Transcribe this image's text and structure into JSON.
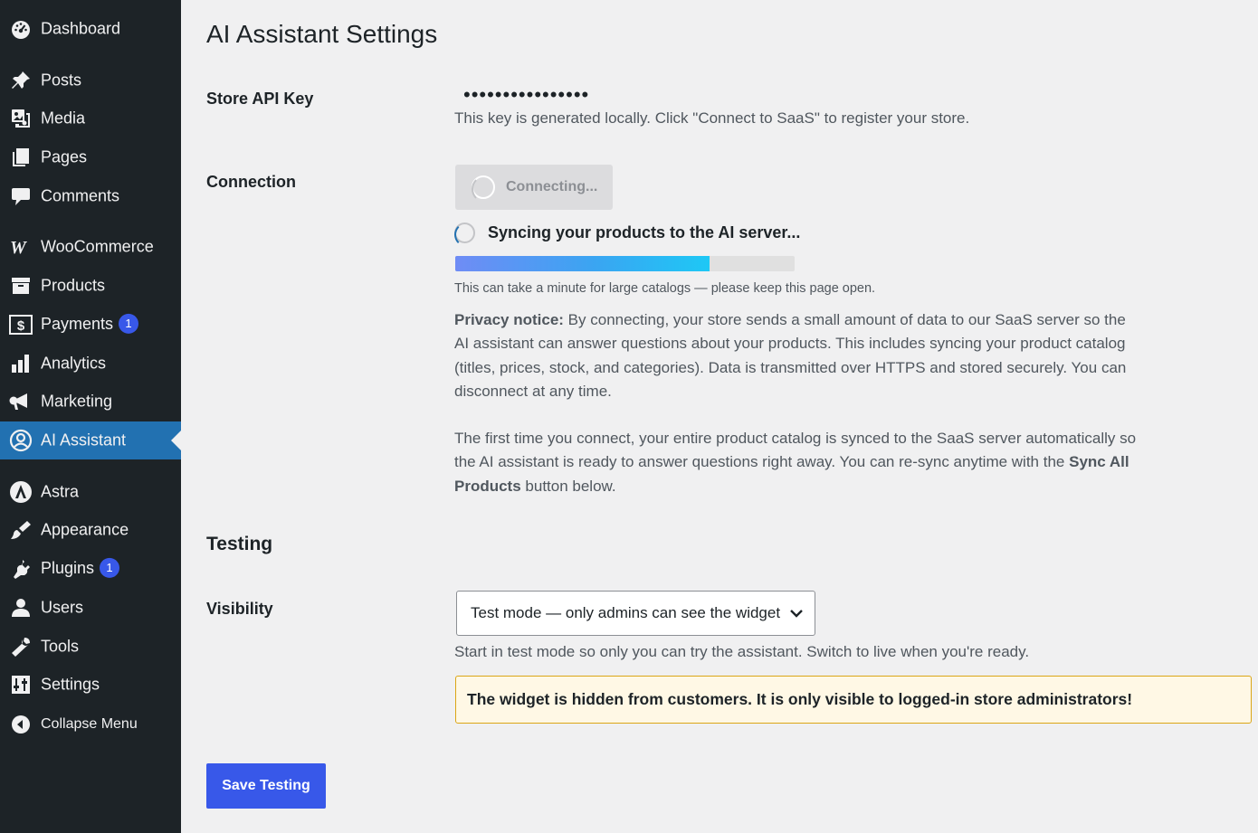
{
  "sidebar": {
    "items": [
      {
        "label": "Dashboard",
        "icon": "dashboard-icon"
      },
      {
        "label": "Posts",
        "icon": "pushpin-icon"
      },
      {
        "label": "Media",
        "icon": "media-icon"
      },
      {
        "label": "Pages",
        "icon": "pages-icon"
      },
      {
        "label": "Comments",
        "icon": "comment-icon"
      },
      {
        "label": "WooCommerce",
        "icon": "woocommerce-icon"
      },
      {
        "label": "Products",
        "icon": "archive-icon"
      },
      {
        "label": "Payments",
        "icon": "dollar-icon",
        "badge": "1"
      },
      {
        "label": "Analytics",
        "icon": "bar-chart-icon"
      },
      {
        "label": "Marketing",
        "icon": "megaphone-icon"
      },
      {
        "label": "AI Assistant",
        "icon": "user-circle-icon"
      },
      {
        "label": "Astra",
        "icon": "astra-icon"
      },
      {
        "label": "Appearance",
        "icon": "paintbrush-icon"
      },
      {
        "label": "Plugins",
        "icon": "plug-icon",
        "badge": "1"
      },
      {
        "label": "Users",
        "icon": "user-icon"
      },
      {
        "label": "Tools",
        "icon": "wrench-icon"
      },
      {
        "label": "Settings",
        "icon": "settings-sliders-icon"
      },
      {
        "label": "Collapse Menu",
        "icon": "collapse-arrow-icon"
      }
    ]
  },
  "page": {
    "title": "AI Assistant Settings"
  },
  "store_api_key": {
    "label": "Store API Key",
    "value": "••••••••••••••••",
    "description": "This key is generated locally. Click \"Connect to SaaS\" to register your store."
  },
  "connection": {
    "label": "Connection",
    "button_label": "Connecting...",
    "sync_text": "Syncing your products to the AI server...",
    "progress": 0.75,
    "hint": "This can take a minute for large catalogs — please keep this page open.",
    "privacy_title": "Privacy notice:",
    "privacy_text": " By connecting, your store sends a small amount of data to our SaaS server so the AI assistant can answer questions about your products. This includes syncing your product catalog (titles, prices, stock, and categories). Data is transmitted over HTTPS and stored securely. You can disconnect at any time.",
    "sync_info_before": "The first time you connect, your entire product catalog is synced to the SaaS server automatically so the AI assistant is ready to answer questions right away. You can re-sync anytime with the ",
    "sync_info_bold": "Sync All Products",
    "sync_info_after": " button below."
  },
  "testing": {
    "heading": "Testing",
    "visibility_label": "Visibility",
    "select_value": "Test mode — only admins can see the widget",
    "description": "Start in test mode so only you can try the assistant. Switch to live when you're ready.",
    "notice": "The widget is hidden from customers. It is only visible to logged-in store administrators!",
    "save_label": "Save Testing"
  },
  "colors": {
    "sidebar_bg": "#1d2327",
    "sidebar_current": "#2271b1",
    "primary_button": "#3858e9",
    "notice_bg": "#fff8e5",
    "notice_border": "#dba617"
  }
}
